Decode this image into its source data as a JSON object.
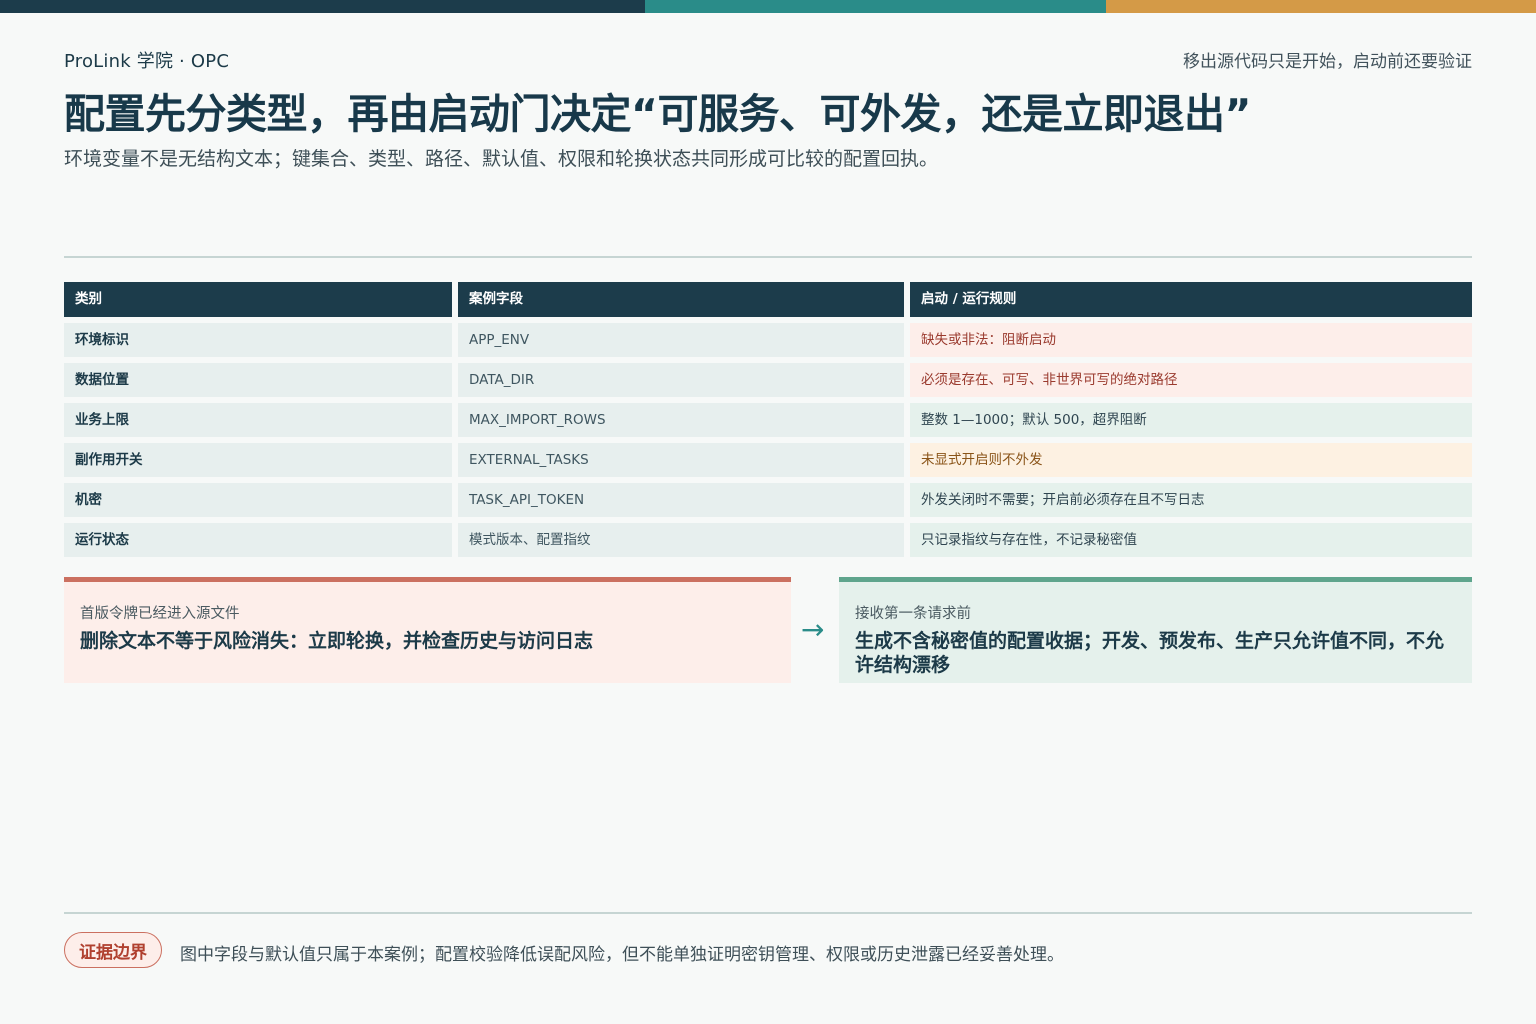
{
  "header": {
    "brand": "ProLink 学院 · OPC",
    "tagline": "移出源代码只是开始，启动前还要验证",
    "title": "配置先分类型，再由启动门决定“可服务、可外发，还是立即退出”",
    "subtitle": "环境变量不是无结构文本；键集合、类型、路径、默认值、权限和轮换状态共同形成可比较的配置回执。"
  },
  "table": {
    "headers": [
      "类别",
      "案例字段",
      "启动 / 运行规则"
    ],
    "rows": [
      {
        "category": "环境标识",
        "field": "APP_ENV",
        "rule": "缺失或非法：阻断启动"
      },
      {
        "category": "数据位置",
        "field": "DATA_DIR",
        "rule": "必须是存在、可写、非世界可写的绝对路径"
      },
      {
        "category": "业务上限",
        "field": "MAX_IMPORT_ROWS",
        "rule": "整数 1—1000；默认 500，超界阻断"
      },
      {
        "category": "副作用开关",
        "field": "EXTERNAL_TASKS",
        "rule": "未显式开启则不外发"
      },
      {
        "category": "机密",
        "field": "TASK_API_TOKEN",
        "rule": "外发关闭时不需要；开启前必须存在且不写日志"
      },
      {
        "category": "运行状态",
        "field": "模式版本、配置指纹",
        "rule": "只记录指纹与存在性，不记录秘密值"
      }
    ]
  },
  "cards": {
    "left": {
      "label": "首版令牌已经进入源文件",
      "text": "删除文本不等于风险消失：立即轮换，并检查历史与访问日志"
    },
    "arrow": "→",
    "right": {
      "label": "接收第一条请求前",
      "text": "生成不含秘密值的配置收据；开发、预发布、生产只允许值不同，不允许结构漂移"
    }
  },
  "footer": {
    "badge": "证据边界",
    "note": "图中字段与默认值只属于本案例；配置校验降低误配风险，但不能单独证明密钥管理、权限或历史泄露已经妥善处理。"
  },
  "colors": {
    "navy": "#1c3c4b",
    "teal": "#2a8c89",
    "amber": "#d49a47",
    "risk_red": "#cb7060",
    "safe_green": "#5fa58d"
  }
}
